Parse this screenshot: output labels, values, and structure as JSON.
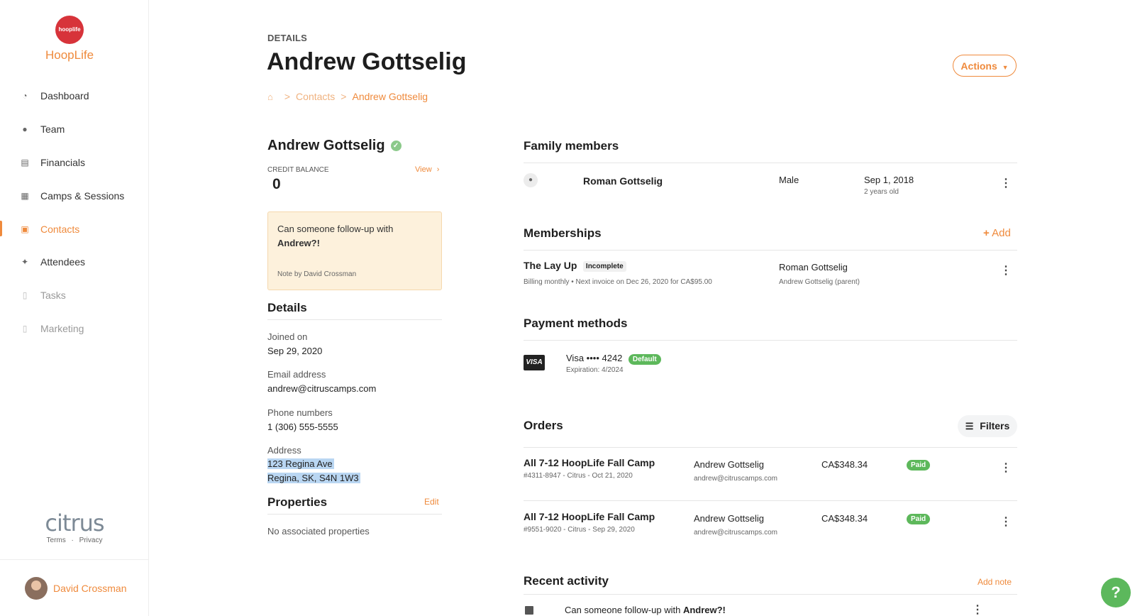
{
  "app": {
    "logo_text": "hooplife",
    "name": "HoopLife"
  },
  "sidebar": {
    "items": [
      {
        "label": "Dashboard",
        "icon": "speedometer-icon"
      },
      {
        "label": "Team",
        "icon": "team-icon"
      },
      {
        "label": "Financials",
        "icon": "document-icon"
      },
      {
        "label": "Camps & Sessions",
        "icon": "calendar-icon"
      },
      {
        "label": "Contacts",
        "icon": "contacts-icon",
        "active": true
      },
      {
        "label": "Attendees",
        "icon": "runner-icon"
      },
      {
        "label": "Tasks",
        "icon": "clipboard-icon",
        "muted": true
      },
      {
        "label": "Marketing",
        "icon": "clipboard-icon",
        "muted": true
      }
    ],
    "brand": "citrus",
    "terms": "Terms",
    "dot": "·",
    "privacy": "Privacy",
    "user_name": "David Crossman"
  },
  "header": {
    "eyebrow": "DETAILS",
    "title": "Andrew Gottselig",
    "actions_label": "Actions",
    "breadcrumb": {
      "sep": ">",
      "contacts": "Contacts",
      "current": "Andrew Gottselig"
    }
  },
  "contact": {
    "name": "Andrew Gottselig",
    "credit_label": "CREDIT BALANCE",
    "credit_view": "View",
    "credit_value": "0",
    "note": {
      "text_before": "Can someone follow-up with",
      "text_bold": "Andrew?!",
      "by": "Note by David Crossman"
    },
    "details_heading": "Details",
    "joined_label": "Joined on",
    "joined_value": "Sep 29, 2020",
    "email_label": "Email address",
    "email_value": "andrew@citruscamps.com",
    "phone_label": "Phone numbers",
    "phone_value": "1 (306) 555-5555",
    "address_label": "Address",
    "address_line1": "123 Regina Ave",
    "address_line2": "Regina, SK, S4N 1W3",
    "properties_heading": "Properties",
    "properties_edit": "Edit",
    "properties_empty": "No associated properties"
  },
  "family": {
    "heading": "Family members",
    "members": [
      {
        "name": "Roman Gottselig",
        "gender": "Male",
        "dob": "Sep 1, 2018",
        "age": "2 years old"
      }
    ]
  },
  "memberships": {
    "heading": "Memberships",
    "add_label": "Add",
    "items": [
      {
        "name": "The Lay Up",
        "status": "Incomplete",
        "billing": "Billing monthly • Next invoice on Dec 26, 2020 for CA$95.00",
        "member": "Roman Gottselig",
        "payer": "Andrew Gottselig (parent)"
      }
    ]
  },
  "payment": {
    "heading": "Payment methods",
    "card_brand": "VISA",
    "card_label": "Visa •••• 4242",
    "default_badge": "Default",
    "expiration": "Expiration: 4/2024"
  },
  "orders": {
    "heading": "Orders",
    "filters_label": "Filters",
    "items": [
      {
        "title": "All 7-12 HoopLife Fall Camp",
        "meta": "#4311-8947 - Citrus - Oct 21, 2020",
        "customer": "Andrew Gottselig",
        "email": "andrew@citruscamps.com",
        "amount": "CA$348.34",
        "status": "Paid"
      },
      {
        "title": "All 7-12 HoopLife Fall Camp",
        "meta": "#9551-9020 - Citrus - Sep 29, 2020",
        "customer": "Andrew Gottselig",
        "email": "andrew@citruscamps.com",
        "amount": "CA$348.34",
        "status": "Paid"
      }
    ]
  },
  "activity": {
    "heading": "Recent activity",
    "add_note": "Add note",
    "items": [
      {
        "text_before": "Can someone follow-up with",
        "text_bold": "Andrew?!"
      }
    ]
  },
  "help_label": "?",
  "colors": {
    "accent": "#ef8a3c",
    "logo": "#d7333a",
    "success": "#5db85b",
    "note_bg": "#fdf1dc",
    "selection": "#b9d6f2"
  }
}
